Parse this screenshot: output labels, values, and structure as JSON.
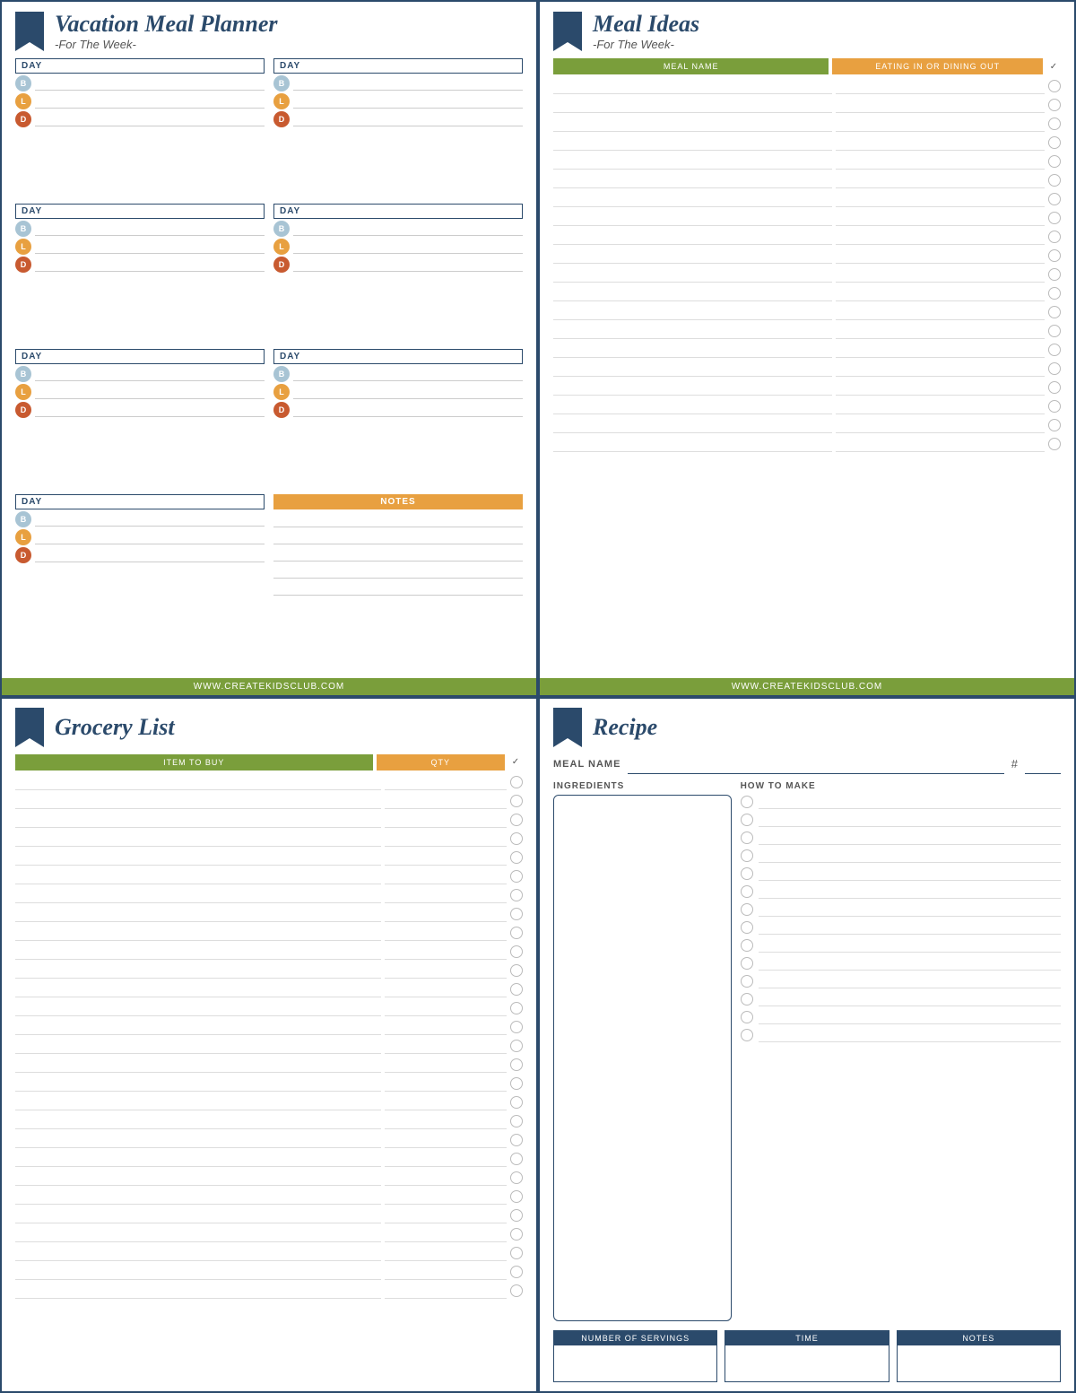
{
  "topLeft": {
    "title": "Vacation Meal Planner",
    "subtitle": "-For The Week-",
    "days": [
      {
        "label": "DAY"
      },
      {
        "label": "DAY"
      },
      {
        "label": "DAY"
      },
      {
        "label": "DAY"
      },
      {
        "label": "DAY"
      },
      {
        "label": "DAY"
      },
      {
        "label": "DAY"
      }
    ],
    "badges": {
      "b": "B",
      "l": "L",
      "d": "D"
    },
    "notesLabel": "NOTES",
    "website": "WWW.CREATEKIDSCLUB.COM"
  },
  "topRight": {
    "title": "Meal Ideas",
    "subtitle": "-For The Week-",
    "colName": "MEAL NAME",
    "colEating": "EATING IN OR DINING OUT",
    "checkMark": "✓",
    "rowCount": 20,
    "website": "WWW.CREATEKIDSCLUB.COM"
  },
  "bottomLeft": {
    "title": "Grocery List",
    "colItem": "ITEM TO BUY",
    "colQty": "QTY",
    "checkMark": "✓",
    "rowCount": 28
  },
  "bottomRight": {
    "title": "Recipe",
    "mealLabel": "MEAL NAME",
    "hashSymbol": "#",
    "ingredientsLabel": "INGREDIENTS",
    "howToMakeLabel": "HOW TO MAKE",
    "howToMakeRows": 14,
    "bottomBoxes": [
      {
        "label": "NUMBER OF SERVINGS"
      },
      {
        "label": "TIME"
      },
      {
        "label": "NOTES"
      }
    ]
  },
  "colors": {
    "navy": "#2b4a6b",
    "green": "#7a9e3b",
    "orange": "#e8a040",
    "badgeBlue": "#a8c4d4",
    "badgeOrange": "#e8a040",
    "badgeRed": "#c85a30"
  }
}
